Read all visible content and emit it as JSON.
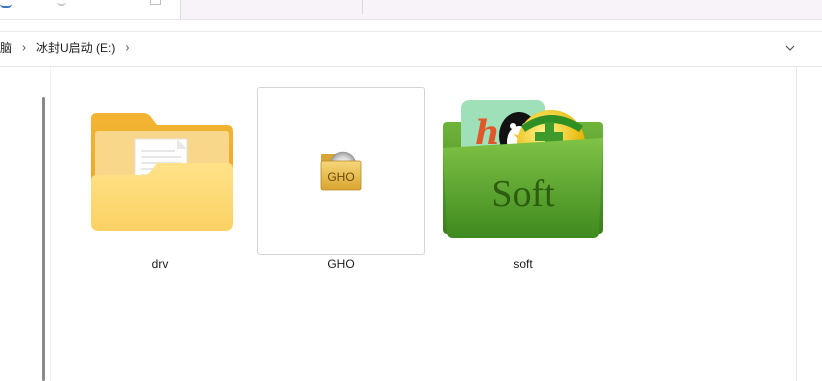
{
  "breadcrumb": {
    "items": [
      "脑",
      "冰封U启动 (E:)"
    ]
  },
  "files": [
    {
      "name": "drv",
      "icon": "folder-icon",
      "selected": false
    },
    {
      "name": "GHO",
      "icon": "gho-file-icon",
      "selected": true,
      "icon_text": "GHO"
    },
    {
      "name": "soft",
      "icon": "soft-folder-icon",
      "selected": false,
      "icon_text": "Soft"
    }
  ],
  "colors": {
    "folder": "#f6c445",
    "soft_green": "#5aa733",
    "accent": "#3a78c5"
  }
}
